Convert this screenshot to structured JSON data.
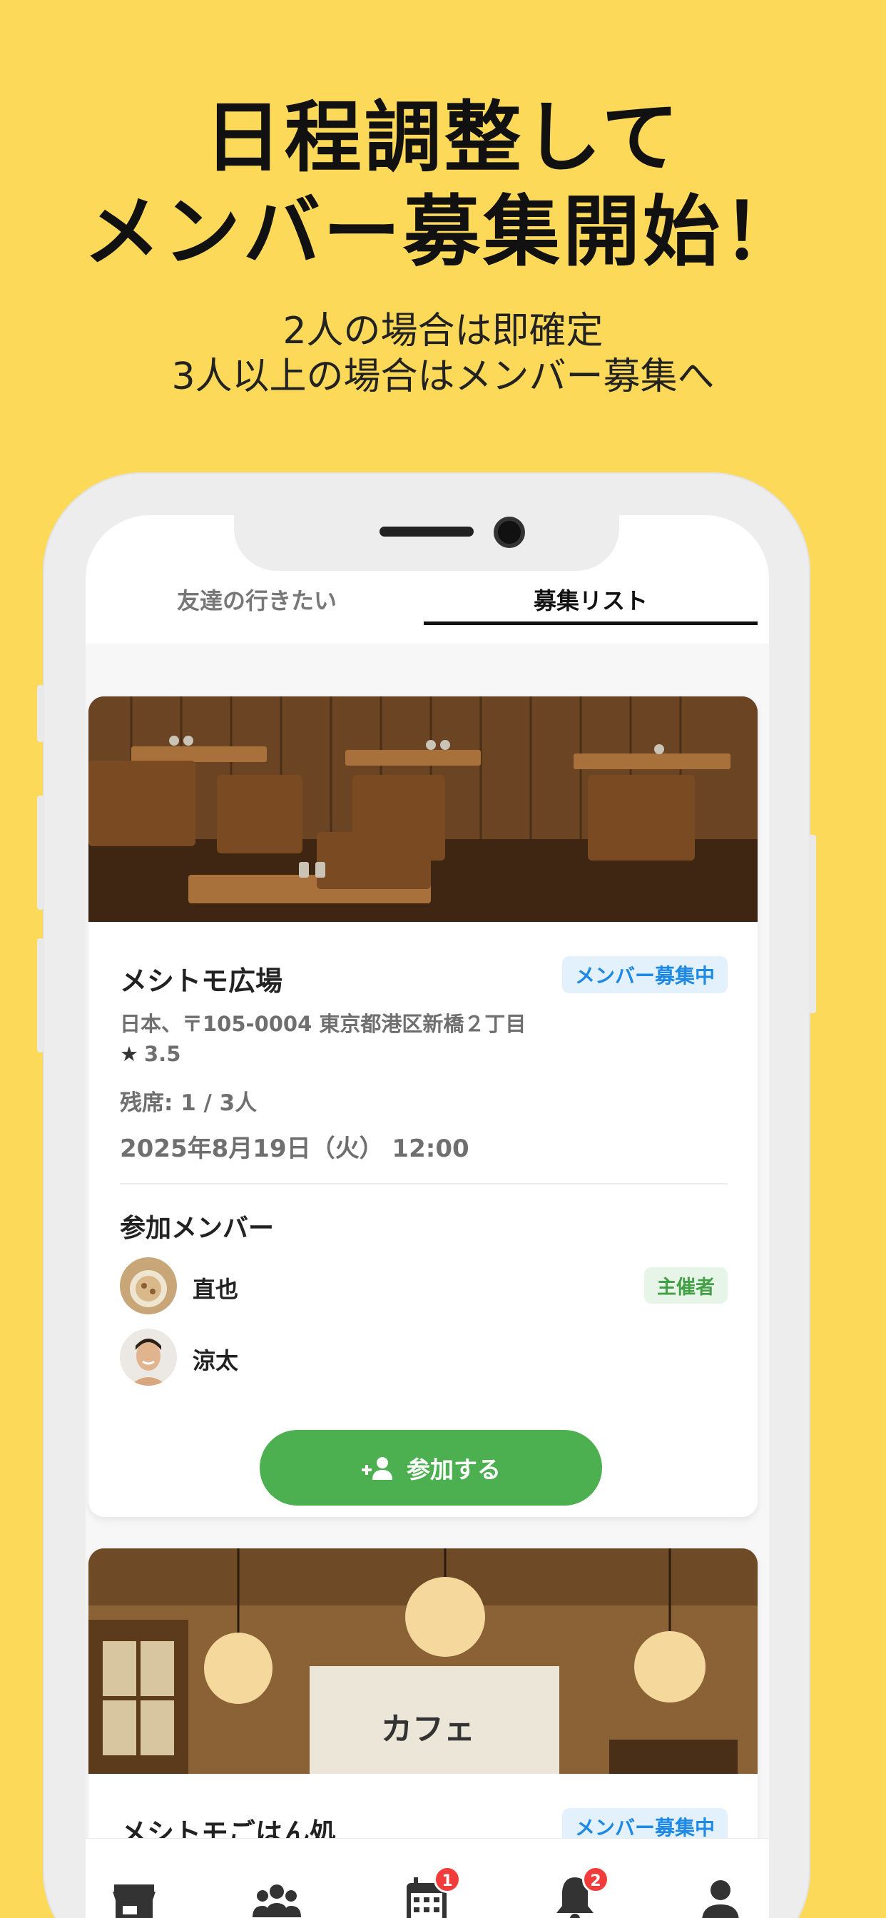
{
  "promo": {
    "headline_line1": "日程調整して",
    "headline_line2": "メンバー募集開始！",
    "sub_line1": "2人の場合は即確定",
    "sub_line2": "3人以上の場合はメンバー募集へ"
  },
  "tabs": [
    {
      "label": "友達の行きたい",
      "active": false
    },
    {
      "label": "募集リスト",
      "active": true
    }
  ],
  "cards": [
    {
      "title": "メシトモ広場",
      "status_badge": "メンバー募集中",
      "address": "日本、〒105-0004 東京都港区新橋２丁目",
      "rating": "3.5",
      "seats": "残席: 1 / 3人",
      "datetime": "2025年8月19日（火） 12:00",
      "members_heading": "参加メンバー",
      "members": [
        {
          "name": "直也",
          "role": "主催者"
        },
        {
          "name": "涼太",
          "role": ""
        }
      ],
      "join_label": "参加する"
    },
    {
      "title": "メシトモごはん処",
      "status_badge": "メンバー募集中",
      "photo_sign": "カフェ"
    }
  ],
  "bottom_nav": [
    {
      "icon": "store-icon",
      "badge": ""
    },
    {
      "icon": "group-icon",
      "badge": ""
    },
    {
      "icon": "calendar-icon",
      "badge": "1"
    },
    {
      "icon": "bell-icon",
      "badge": "2"
    },
    {
      "icon": "person-icon",
      "badge": ""
    }
  ],
  "colors": {
    "background": "#FDD959",
    "accent_green": "#4CAF50",
    "badge_blue": "#1E88E5",
    "notification_red": "#F23B3B"
  }
}
